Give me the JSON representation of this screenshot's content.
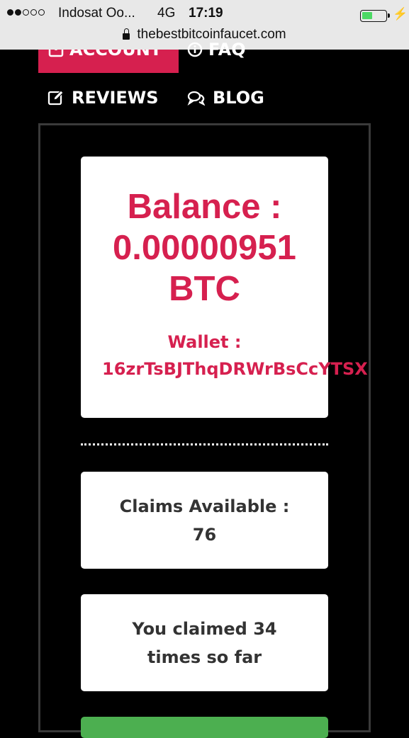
{
  "status_bar": {
    "carrier": "Indosat Oo...",
    "network": "4G",
    "time": "17:19",
    "battery_level": 0.45
  },
  "browser": {
    "url": "thebestbitcoinfaucet.com"
  },
  "nav": {
    "account": "ACCOUNT",
    "faq": "FAQ",
    "reviews": "REVIEWS",
    "blog": "BLOG"
  },
  "balance": {
    "line1": "Balance :",
    "line2": "0.00000951",
    "line3": "BTC",
    "wallet_label": "Wallet :",
    "wallet_address": "16zrTsBJThqDRWrBsCcYTSX"
  },
  "claims": {
    "line1": "Claims Available :",
    "line2": "76"
  },
  "claimed": {
    "line1": "You claimed 34",
    "line2": "times so far"
  },
  "colors": {
    "accent": "#d6204f",
    "button_green": "#4caf50",
    "background": "#000000"
  },
  "icons": [
    "lock-icon",
    "user-icon",
    "info-icon",
    "edit-icon",
    "comments-icon"
  ]
}
